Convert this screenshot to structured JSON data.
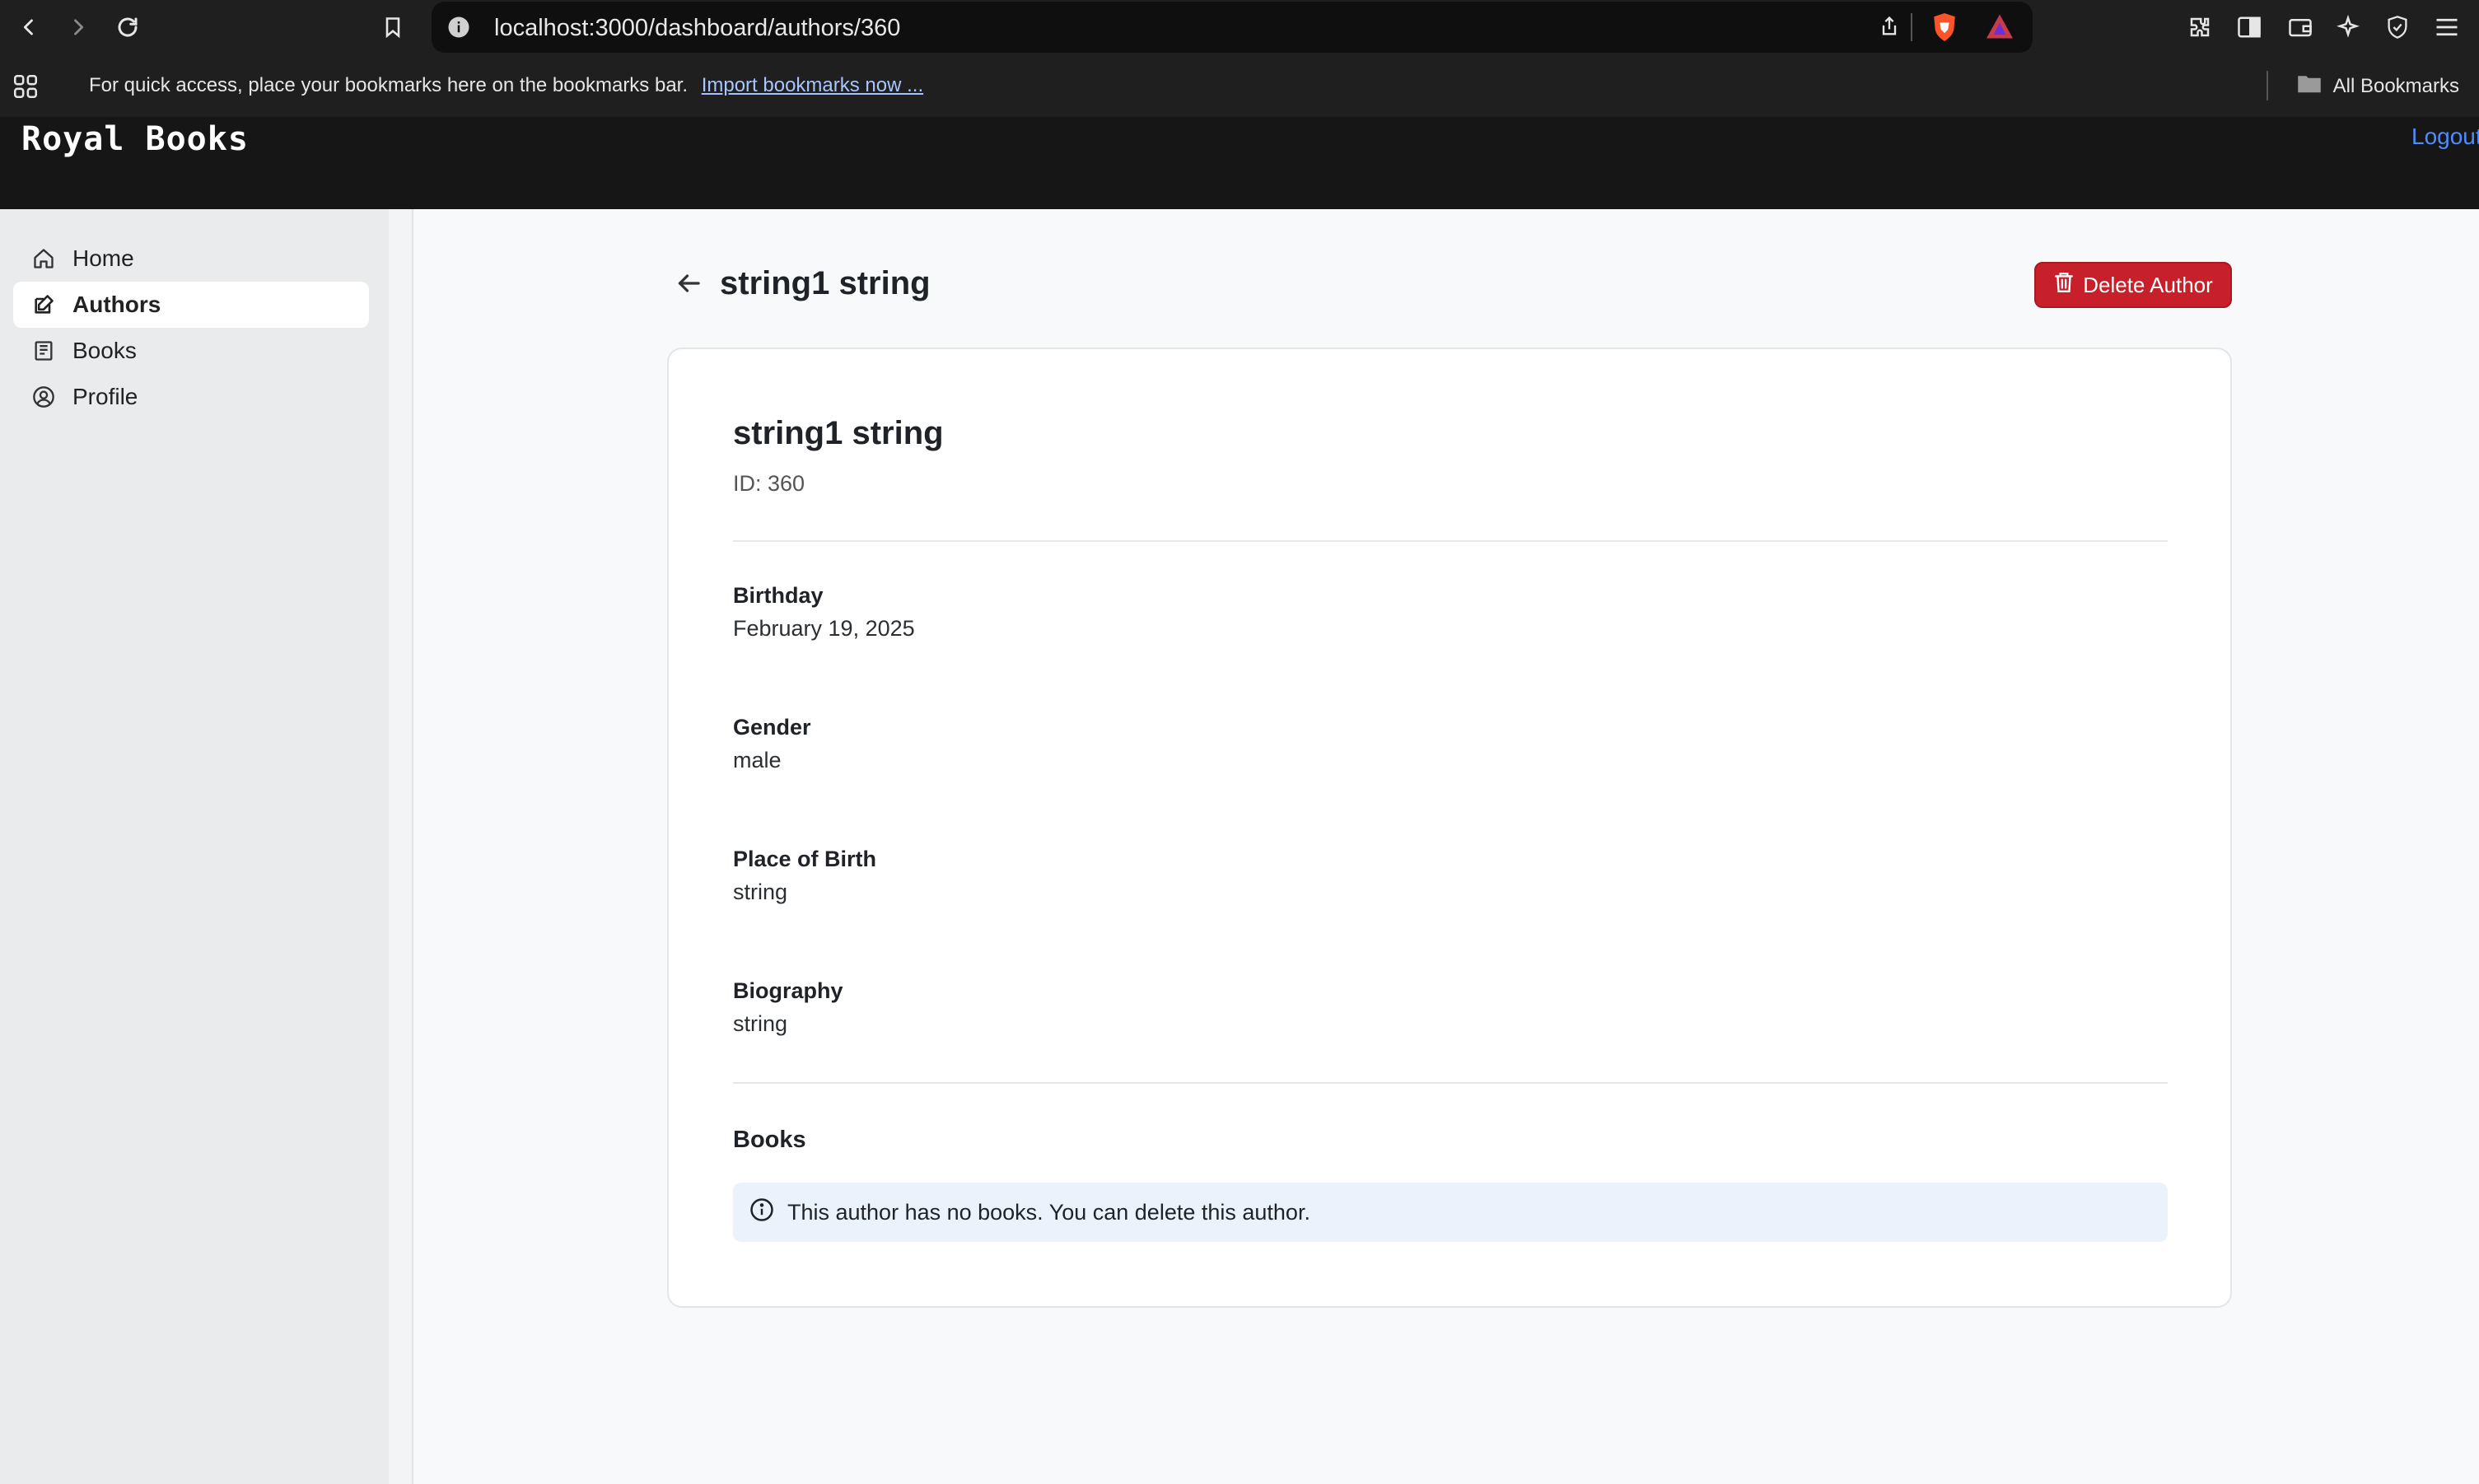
{
  "browser": {
    "url": "localhost:3000/dashboard/authors/360",
    "bookmarks_message": "For quick access, place your bookmarks here on the bookmarks bar.",
    "import_link": "Import bookmarks now ...",
    "all_bookmarks": "All Bookmarks"
  },
  "header": {
    "brand": "Royal Books",
    "logout": "Logout"
  },
  "sidebar": {
    "items": [
      {
        "label": "Home",
        "icon": "home-icon",
        "active": false
      },
      {
        "label": "Authors",
        "icon": "edit-icon",
        "active": true
      },
      {
        "label": "Books",
        "icon": "book-icon",
        "active": false
      },
      {
        "label": "Profile",
        "icon": "user-circle-icon",
        "active": false
      }
    ]
  },
  "page": {
    "title": "string1 string",
    "delete_label": "Delete Author"
  },
  "author": {
    "name": "string1 string",
    "id_text": "ID: 360",
    "fields": [
      {
        "label": "Birthday",
        "value": "February 19, 2025"
      },
      {
        "label": "Gender",
        "value": "male"
      },
      {
        "label": "Place of Birth",
        "value": "string"
      },
      {
        "label": "Biography",
        "value": "string"
      }
    ],
    "books_heading": "Books",
    "books_notice": "This author has no books. You can delete this author."
  },
  "colors": {
    "delete_button": "#c8202a",
    "logout_link": "#4e8cff",
    "info_background": "#eaf3fc",
    "header_background": "#161616"
  }
}
